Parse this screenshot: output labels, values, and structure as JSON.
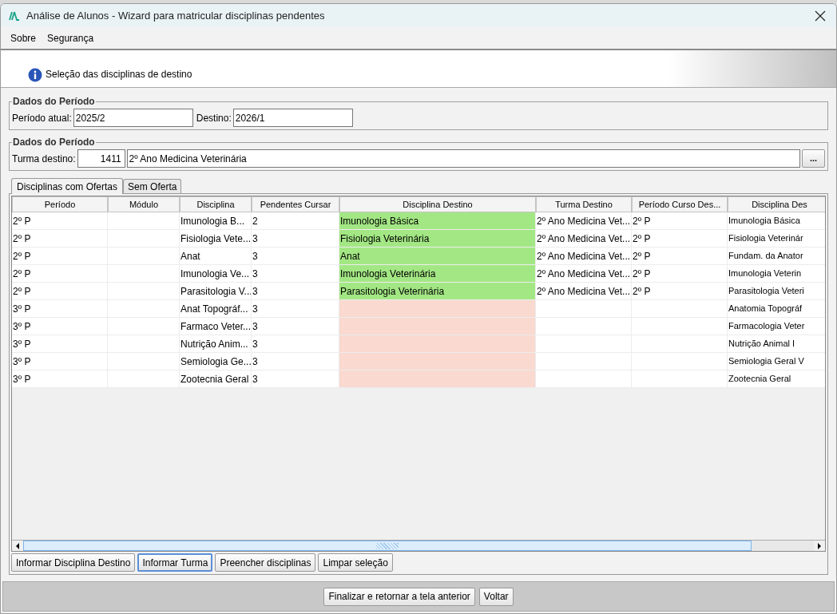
{
  "window": {
    "title": "Análise de Alunos - Wizard para matricular disciplinas pendentes"
  },
  "menu": [
    "Sobre",
    "Segurança"
  ],
  "header": {
    "text": "Seleção das disciplinas de destino"
  },
  "periodo_group": {
    "title": "Dados do Período",
    "atual_label": "Período atual:",
    "atual_value": "2025/2",
    "destino_label": "Destino:",
    "destino_value": "2026/1"
  },
  "turma_group": {
    "title": "Dados do Período",
    "label": "Turma destino:",
    "code": "1411",
    "name": "2º Ano Medicina Veterinária",
    "button": "..."
  },
  "tabs": [
    {
      "label": "Disciplinas com Ofertas",
      "selected": true
    },
    {
      "label": "Sem Oferta",
      "selected": false
    }
  ],
  "table": {
    "columns": [
      "Período",
      "Módulo",
      "Disciplina",
      "Pendentes Cursar",
      "Disciplina Destino",
      "Turma Destino",
      "Período Curso Des...",
      "Disciplina Des"
    ],
    "rows": [
      {
        "cells": [
          "2º P",
          "",
          "Imunologia B...",
          "2",
          "Imunologia Básica",
          "2º Ano Medicina Vet...",
          "2º P",
          "Imunologia Básica"
        ],
        "color": "#a3e784"
      },
      {
        "cells": [
          "2º P",
          "",
          "Fisiologia Vete...",
          "3",
          "Fisiologia Veterinária",
          "2º Ano Medicina Vet...",
          "2º P",
          "Fisiologia Veterinár"
        ],
        "color": "#a3e784"
      },
      {
        "cells": [
          "2º P",
          "",
          "Anat",
          "3",
          "Anat",
          "2º Ano Medicina Vet...",
          "2º P",
          "Fundam. da Anator"
        ],
        "color": "#a3e784"
      },
      {
        "cells": [
          "2º P",
          "",
          "Imunologia Ve...",
          "3",
          "Imunologia Veterinária",
          "2º Ano Medicina Vet...",
          "2º P",
          "Imunologia Veterin"
        ],
        "color": "#a3e784"
      },
      {
        "cells": [
          "2º P",
          "",
          "Parasitologia V...",
          "3",
          "Parasitologia Veterinária",
          "2º Ano Medicina Vet...",
          "2º P",
          "Parasitologia Veteri"
        ],
        "color": "#a3e784"
      },
      {
        "cells": [
          "3º P",
          "",
          "Anat Topográf...",
          "3",
          "",
          "",
          "",
          "Anatomia Topográf"
        ],
        "color": "#f9d9d0"
      },
      {
        "cells": [
          "3º P",
          "",
          "Farmaco Veter...",
          "3",
          "",
          "",
          "",
          "Farmacologia Veter"
        ],
        "color": "#f9d9d0"
      },
      {
        "cells": [
          "3º P",
          "",
          "Nutrição Anim...",
          "3",
          "",
          "",
          "",
          "Nutrição Animal I"
        ],
        "color": "#f9d9d0"
      },
      {
        "cells": [
          "3º P",
          "",
          "Semiologia Ge...",
          "3",
          "",
          "",
          "",
          "Semiologia Geral V"
        ],
        "color": "#f9d9d0"
      },
      {
        "cells": [
          "3º P",
          "",
          "Zootecnia Geral",
          "3",
          "",
          "",
          "",
          "Zootecnia Geral"
        ],
        "color": "#f9d9d0"
      }
    ]
  },
  "actions": [
    {
      "label": "Informar Disciplina Destino",
      "focused": false
    },
    {
      "label": "Informar Turma",
      "focused": true
    },
    {
      "label": "Preencher disciplinas",
      "focused": false
    },
    {
      "label": "Limpar seleção",
      "focused": false
    }
  ],
  "footer_buttons": [
    "Finalizar e retornar a tela anterior",
    "Voltar"
  ]
}
